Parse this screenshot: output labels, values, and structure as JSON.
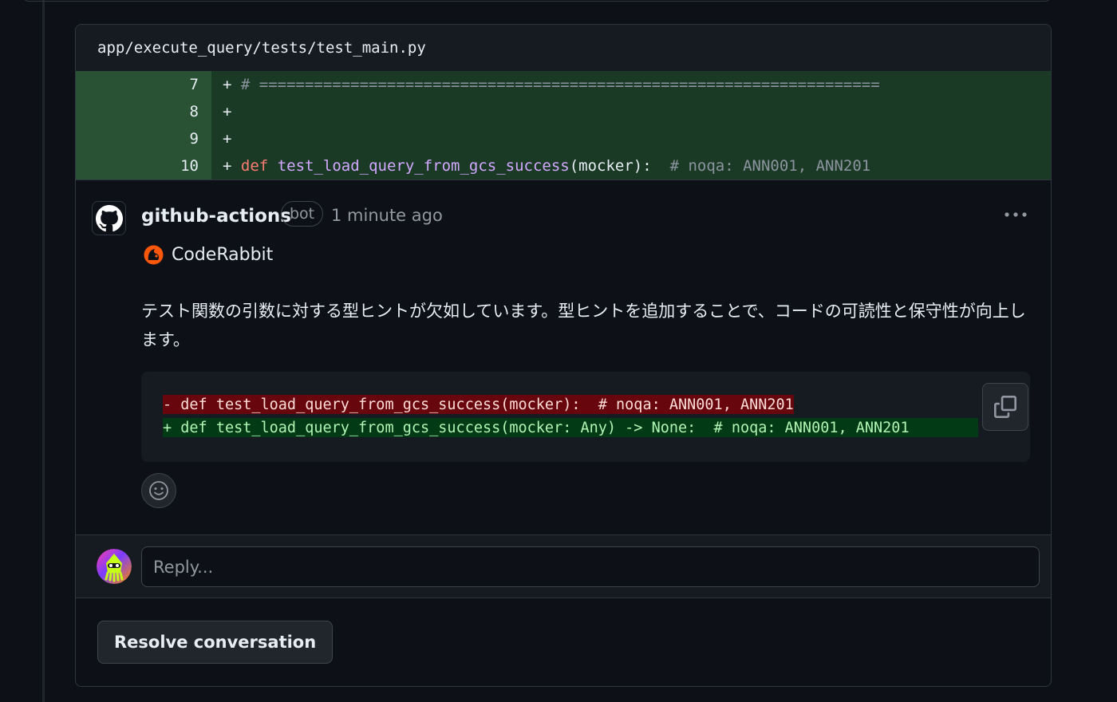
{
  "file": {
    "path": "app/execute_query/tests/test_main.py"
  },
  "diff": {
    "rows": [
      {
        "num": "7",
        "plus": "+",
        "comment": "# ===================================================================="
      },
      {
        "num": "8",
        "plus": "+"
      },
      {
        "num": "9",
        "plus": "+"
      },
      {
        "num": "10",
        "plus": "+",
        "kw": "def",
        "fn": "test_load_query_from_gcs_success",
        "rest": "(mocker):  ",
        "comment": "# noqa: ANN001, ANN201"
      }
    ]
  },
  "comment": {
    "author": "github-actions",
    "badge": "bot",
    "time": "1 minute ago",
    "more_icon": "kebab-horizontal-icon",
    "bot_name": "CodeRabbit",
    "body": "テスト関数の引数に対する型ヒントが欠如しています。型ヒントを追加することで、コードの可読性と保守性が向上します。",
    "suggestion": {
      "removed": "- def test_load_query_from_gcs_success(mocker):  # noqa: ANN001, ANN201",
      "added": "+ def test_load_query_from_gcs_success(mocker: Any) -> None:  # noqa: ANN001, ANN201"
    }
  },
  "reply": {
    "placeholder": "Reply..."
  },
  "actions": {
    "resolve_label": "Resolve conversation"
  },
  "colors": {
    "diff_add_bg": "#1b3a26",
    "diff_num_bg": "#295234",
    "removed_bg": "#67060c",
    "added_bg": "#033a16",
    "keyword": "#ff7b72",
    "function": "#d2a8ff"
  }
}
